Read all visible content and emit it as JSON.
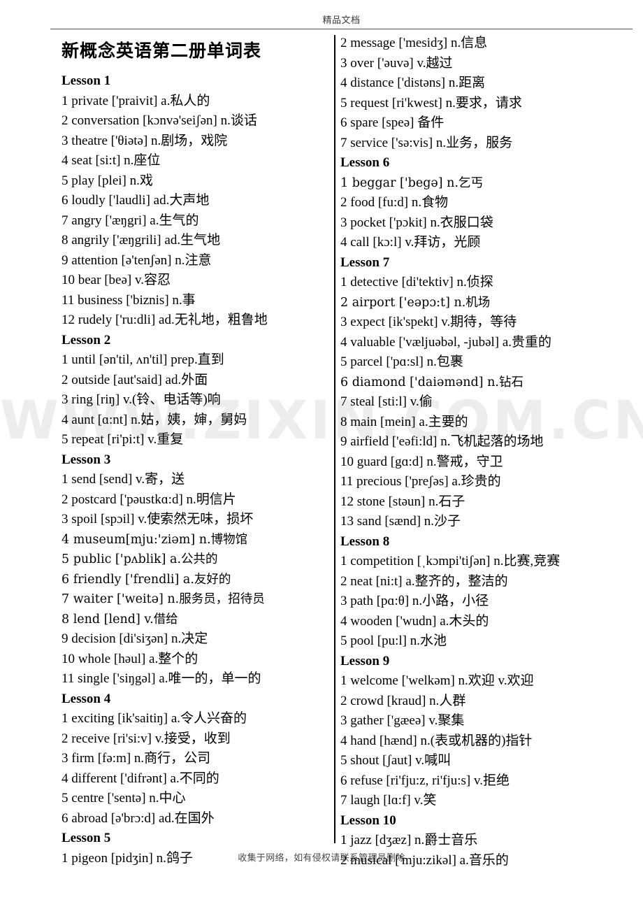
{
  "page": {
    "header_text": "精品文档",
    "footer_text": "收集于网络，如有侵权请联系管理员删除",
    "watermark_text": "WWW.ZIXIN.COM.CN",
    "title": "新概念英语第二册单词表"
  },
  "left_column": {
    "blocks": [
      {
        "type": "lesson",
        "label": "Lesson 1"
      },
      {
        "type": "entry",
        "text": "1 private  ['praivit] a.私人的"
      },
      {
        "type": "entry",
        "text": "2 conversation [kɔnvə'seiʃən] n.谈话"
      },
      {
        "type": "entry",
        "text": "3 theatre  ['θiətə] n.剧场，戏院"
      },
      {
        "type": "entry",
        "text": "4 seat [si:t] n.座位"
      },
      {
        "type": "entry",
        "text": "5 play [plei] n.戏"
      },
      {
        "type": "entry",
        "text": "6 loudly ['laudli] ad.大声地"
      },
      {
        "type": "entry",
        "text": "7 angry ['æŋgri] a.生气的"
      },
      {
        "type": "entry",
        "text": "8 angrily ['æŋgrili] ad.生气地"
      },
      {
        "type": "entry",
        "text": "9 attention [ə'tenʃən] n.注意"
      },
      {
        "type": "entry",
        "text": "10 bear    [beə] v.容忍"
      },
      {
        "type": "entry",
        "text": "11 business ['biznis] n.事"
      },
      {
        "type": "entry",
        "text": "12 rudely ['ru:dli] ad.无礼地，粗鲁地"
      },
      {
        "type": "lesson",
        "label": "Lesson 2"
      },
      {
        "type": "entry",
        "text": "1 until [ən'til, ʌn'til] prep.直到"
      },
      {
        "type": "entry",
        "text": "2 outside [aut'said] ad.外面"
      },
      {
        "type": "entry",
        "text": "3 ring [riŋ] v.(铃、电话等)响"
      },
      {
        "type": "entry",
        "text": "4 aunt [ɑ:nt] n.姑，姨，婶，舅妈"
      },
      {
        "type": "entry",
        "text": "5 repeat [ri'pi:t] v.重复"
      },
      {
        "type": "lesson",
        "label": "Lesson 3"
      },
      {
        "type": "entry",
        "text": "1 send [send] v.寄，送"
      },
      {
        "type": "entry",
        "text": "2 postcard ['pəustkɑ:d] n.明信片"
      },
      {
        "type": "entry",
        "text": "3 spoil [spɔil] v.使索然无味，损坏"
      },
      {
        "type": "entry",
        "text": "4 museum[mju:'ziəm] n.博物馆",
        "style": "alt"
      },
      {
        "type": "entry",
        "text": "5 public ['pʌblik] a.公共的",
        "style": "alt"
      },
      {
        "type": "entry",
        "text": "6 friendly ['frendli] a.友好的",
        "style": "alt"
      },
      {
        "type": "entry",
        "text": "7 waiter ['weitə] n.服务员，招待员",
        "style": "alt"
      },
      {
        "type": "entry",
        "text": "8 lend [lend] v.借给",
        "style": "alt"
      },
      {
        "type": "entry",
        "text": "9 decision [di'siʒən] n.决定"
      },
      {
        "type": "entry",
        "text": "10 whole [həul] a.整个的"
      },
      {
        "type": "entry",
        "text": "11 single ['siŋgəl] a.唯一的，单一的"
      },
      {
        "type": "lesson",
        "label": "Lesson 4"
      },
      {
        "type": "entry",
        "text": "1 exciting [ik'saitiŋ] a.令人兴奋的"
      },
      {
        "type": "entry",
        "text": "2 receive   [ri'si:v] v.接受，收到"
      },
      {
        "type": "entry",
        "text": "3 firm [fə:m] n.商行，公司"
      },
      {
        "type": "entry",
        "text": "4 different ['difrənt] a.不同的"
      },
      {
        "type": "entry",
        "text": "5 centre ['sentə] n.中心"
      },
      {
        "type": "entry",
        "text": "6 abroad    [ə'brɔ:d] ad.在国外"
      },
      {
        "type": "lesson",
        "label": "Lesson 5"
      },
      {
        "type": "entry",
        "text": "1 pigeon [pidʒin] n.鸽子"
      }
    ]
  },
  "right_column": {
    "blocks": [
      {
        "type": "entry",
        "text": "2 message ['mesidʒ] n.信息"
      },
      {
        "type": "entry",
        "text": "3 over ['əuvə] v.越过"
      },
      {
        "type": "entry",
        "text": "4 distance ['distəns] n.距离"
      },
      {
        "type": "entry",
        "text": "5 request [ri'kwest] n.要求，请求"
      },
      {
        "type": "entry",
        "text": "6 spare [speə] 备件"
      },
      {
        "type": "entry",
        "text": "7 service   ['sə:vis] n.业务，服务"
      },
      {
        "type": "lesson",
        "label": "Lesson 6"
      },
      {
        "type": "entry",
        "text": "1 beggar    ['begə] n.乞丐",
        "style": "alt"
      },
      {
        "type": "entry",
        "text": "2 food [fu:d] n.食物"
      },
      {
        "type": "entry",
        "text": "3 pocket    ['pɔkit] n.衣服口袋"
      },
      {
        "type": "entry",
        "text": "4 call [kɔ:l] v.拜访，光顾"
      },
      {
        "type": "lesson",
        "label": "Lesson 7"
      },
      {
        "type": "entry",
        "text": "1 detective [di'tektiv] n.侦探"
      },
      {
        "type": "entry",
        "text": "2 airport ['eəpɔ:t] n.机场",
        "style": "alt"
      },
      {
        "type": "entry",
        "text": "3 expect [ik'spekt] v.期待，等待"
      },
      {
        "type": "entry",
        "text": "4 valuable ['væljuəbəl, -jubəl] a.贵重的"
      },
      {
        "type": "entry",
        "text": "5 parcel ['pɑ:sl] n.包裹"
      },
      {
        "type": "entry",
        "text": "6 diamond ['daiəmənd] n.钻石",
        "style": "alt"
      },
      {
        "type": "entry",
        "text": "7 steal [sti:l] v.偷"
      },
      {
        "type": "entry",
        "text": "8 main [mein] a.主要的"
      },
      {
        "type": "entry",
        "text": "9 airfield   ['eəfi:ld] n.飞机起落的场地"
      },
      {
        "type": "entry",
        "text": "10 guard [gɑ:d] n.警戒，守卫"
      },
      {
        "type": "entry",
        "text": "11 precious ['preʃəs] a.珍贵的"
      },
      {
        "type": "entry",
        "text": "12 stone    [stəun] n.石子"
      },
      {
        "type": "entry",
        "text": "13 sand     [sænd] n.沙子"
      },
      {
        "type": "lesson",
        "label": "Lesson 8"
      },
      {
        "type": "entry",
        "text": "1 competition [ˌkɔmpi'tiʃən] n.比赛,竞赛"
      },
      {
        "type": "entry",
        "text": "2 neat [ni:t] a.整齐的，整洁的"
      },
      {
        "type": "entry",
        "text": "3 path [pɑ:θ] n.小路，小径"
      },
      {
        "type": "entry",
        "text": "4 wooden ['wudn] a.木头的"
      },
      {
        "type": "entry",
        "text": "5 pool [pu:l] n.水池"
      },
      {
        "type": "lesson",
        "label": "Lesson 9"
      },
      {
        "type": "entry",
        "text": "1 welcome ['welkəm] n.欢迎 v.欢迎"
      },
      {
        "type": "entry",
        "text": "2 crowd [kraud] n.人群"
      },
      {
        "type": "entry",
        "text": "3 gather ['gæeə] v.聚集"
      },
      {
        "type": "entry",
        "text": "4 hand [hænd] n.(表或机器的)指针"
      },
      {
        "type": "entry",
        "text": "5 shout [ʃaut] v.喊叫"
      },
      {
        "type": "entry",
        "text": "6 refuse [ri'fju:z, ri'fju:s] v.拒绝"
      },
      {
        "type": "entry",
        "text": "7 laugh [lɑ:f] v.笑"
      },
      {
        "type": "lesson",
        "label": "Lesson 10"
      },
      {
        "type": "entry",
        "text": "1 jazz [dʒæz] n.爵士音乐"
      },
      {
        "type": "entry",
        "text": "2 musical ['mju:zikəl] a.音乐的"
      }
    ]
  }
}
